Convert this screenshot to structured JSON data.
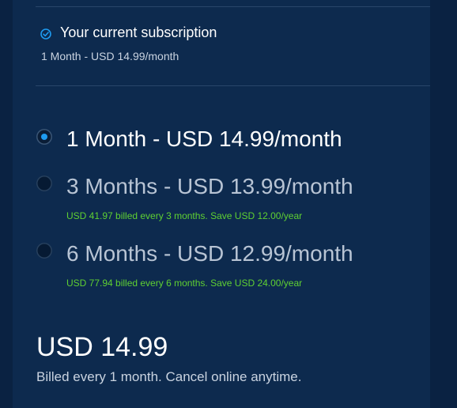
{
  "current_subscription": {
    "title": "Your current subscription",
    "value": "1 Month - USD 14.99/month",
    "icon": "check-circle-icon"
  },
  "plans": [
    {
      "label": "1 Month - USD 14.99/month",
      "note": "",
      "selected": true
    },
    {
      "label": "3 Months - USD 13.99/month",
      "note": "USD 41.97 billed every 3 months. Save USD 12.00/year",
      "selected": false
    },
    {
      "label": "6 Months - USD 12.99/month",
      "note": "USD 77.94 billed every 6 months. Save USD 24.00/year",
      "selected": false
    }
  ],
  "summary": {
    "price": "USD 14.99",
    "billing": "Billed every 1 month. Cancel online anytime."
  },
  "colors": {
    "background": "#0d2a4e",
    "accent": "#1e9bf0",
    "savings": "#5fd032"
  }
}
